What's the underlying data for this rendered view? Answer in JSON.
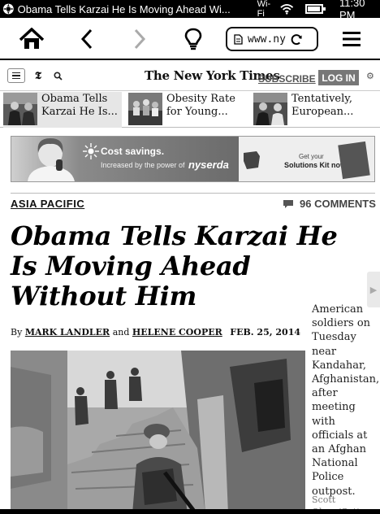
{
  "status_bar": {
    "title": "Obama Tells Karzai He Is Moving Ahead Wi...",
    "wifi_label": "Wi-Fi",
    "time": "11:30 PM",
    "battery_level": 0.85
  },
  "toolbar": {
    "url": "www.ny",
    "icons": [
      "home-icon",
      "back-icon",
      "forward-icon",
      "lightbulb-icon",
      "page-icon",
      "reload-icon",
      "menu-icon"
    ]
  },
  "nyt_header": {
    "t_logo": "𝕿",
    "masthead": "The New York Times",
    "subscribe": "SUBSCRIBE",
    "login": "LOG IN"
  },
  "related": [
    {
      "line1": "Obama Tells",
      "line2": "Karzai He Is..."
    },
    {
      "line1": "Obesity Rate",
      "line2": "for Young..."
    },
    {
      "line1": "Tentatively,",
      "line2": "European..."
    }
  ],
  "ad": {
    "headline": "Cost savings.",
    "sub": "Increased by the power of",
    "brand": "nyserda",
    "cta_line1": "Get your",
    "cta_line2": "Solutions Kit now."
  },
  "article": {
    "section": "ASIA PACIFIC",
    "comments": "96 COMMENTS",
    "headline": "Obama Tells Karzai He Is Moving Ahead Without Him",
    "byline_prefix": "By",
    "author1": "MARK LANDLER",
    "and": "and",
    "author2": "HELENE COOPER",
    "date": "FEB. 25, 2014",
    "caption_lines": [
      "American",
      "soldiers on",
      "Tuesday",
      "near",
      "Kandahar,",
      "Afghanistan,",
      "after",
      "meeting",
      "with",
      "officials at",
      "an Afghan",
      "National",
      "Police",
      "outpost."
    ],
    "credit_lines": [
      "Scott",
      "Olson/Getty"
    ]
  }
}
